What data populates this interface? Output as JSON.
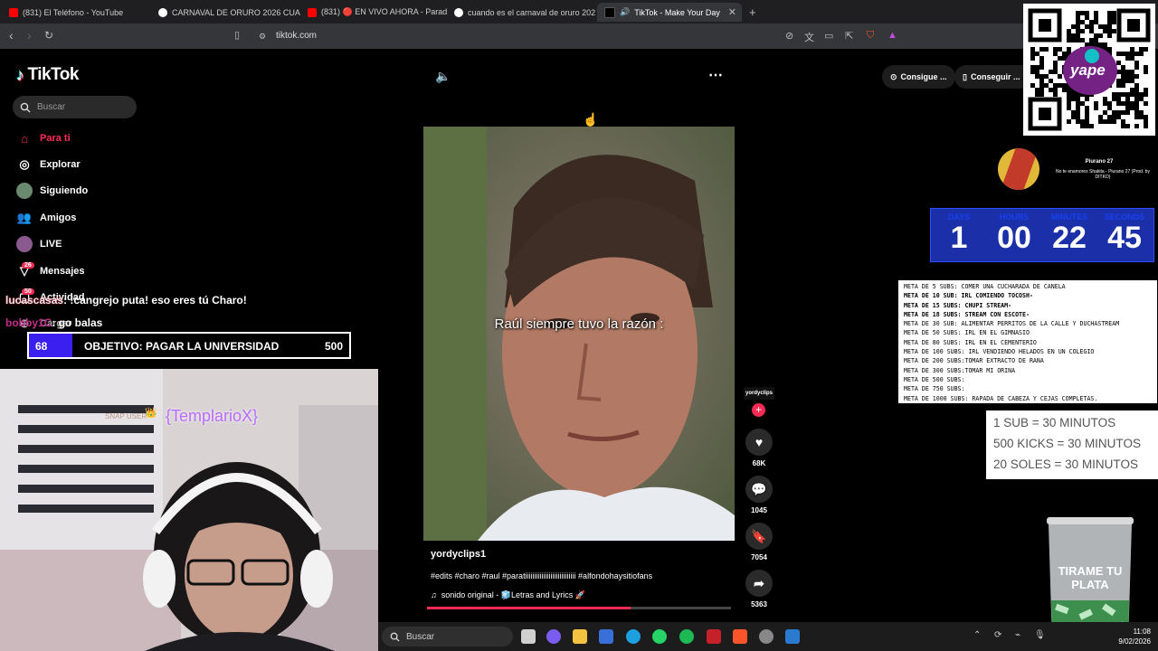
{
  "browser": {
    "tabs": [
      {
        "title": "(831) El Teléfono - YouTube",
        "active": false
      },
      {
        "title": "CARNAVAL DE ORURO 2026 CUANDO",
        "active": false
      },
      {
        "title": "(831) 🔴 EN VIVO AHORA - Parada y",
        "active": false
      },
      {
        "title": "cuando es el carnaval de oruro 2026",
        "active": false
      },
      {
        "title": "TikTok - Make Your Day",
        "active": true
      }
    ],
    "url": "tiktok.com"
  },
  "tiktok": {
    "logo": "TikTok",
    "search_placeholder": "Buscar",
    "nav": [
      {
        "label": "Para ti",
        "icon": "home-icon",
        "active": true
      },
      {
        "label": "Explorar",
        "icon": "compass-icon"
      },
      {
        "label": "Siguiendo",
        "icon": "following-avatar-icon"
      },
      {
        "label": "Amigos",
        "icon": "friends-icon"
      },
      {
        "label": "LIVE",
        "icon": "live-avatar-icon"
      },
      {
        "label": "Mensajes",
        "icon": "messages-icon",
        "badge": "26"
      },
      {
        "label": "Actividad",
        "icon": "activity-icon",
        "badge": "50"
      },
      {
        "label": "Cargar",
        "icon": "upload-icon"
      }
    ],
    "top_buttons": [
      "Consigue ...",
      "Conseguir ..."
    ],
    "video": {
      "caption": "Raúl siempre tuvo la razón :",
      "author": "yordyclips1",
      "tags": "#edits #charo #raul #paratiiiiiiiiiiiiiiiiiiiiiiiiiiii #alfondohaysitiofans",
      "sound": "sonido original - 🧊Letras and Lyrics 🚀",
      "progress": 0.67
    },
    "actions": {
      "likes": "68K",
      "comments": "1045",
      "saves": "7054",
      "shares": "5363",
      "avatar_label": "yordyclips"
    }
  },
  "stream": {
    "chat": [
      {
        "user": "lucascasas",
        "message": ": !cangrejo puta! eso eres tú Charo!"
      },
      {
        "user": "bobby1C",
        "message": ": go balas"
      }
    ],
    "goal": {
      "current": "68",
      "label": "OBJETIVO: PAGAR LA UNIVERSIDAD",
      "target": "500",
      "fraction": 0.136
    },
    "webcam_overlay": {
      "prefix": "SNAP USER",
      "user": "{TemplarioX}"
    },
    "song": {
      "title": "Piurano 27",
      "subtitle": "No te enamores Shakita - Piurano 27 (Prod. by DITKO)"
    },
    "timer": [
      {
        "label": "DAYS",
        "value": "1"
      },
      {
        "label": "HOURS",
        "value": "00"
      },
      {
        "label": "MINUTES",
        "value": "22"
      },
      {
        "label": "SECONDS",
        "value": "45"
      }
    ],
    "metas": [
      {
        "text": "META DE 5 SUBS: COMER UNA CUCHARADA DE CANELA",
        "bold": false
      },
      {
        "text": "META DE 10 SUB: IRL COMIENDO TOCOSH-",
        "bold": true
      },
      {
        "text": "META DE 15 SUBS: CHUPI STREAM-",
        "bold": true
      },
      {
        "text": "META DE 18 SUBS: STREAM CON ESCOTE-",
        "bold": true
      },
      {
        "text": "META DE 30 SUB:  ALIMENTAR PERRITOS DE LA CALLE Y DUCHASTREAM",
        "bold": false
      },
      {
        "text": "META DE 50 SUBS: IRL EN EL GIMNASIO",
        "bold": false
      },
      {
        "text": "META DE 80 SUBS: IRL EN EL CEMENTERIO",
        "bold": false
      },
      {
        "text": "META DE 100 SUBS: IRL VENDIENDO HELADOS EN UN COLEGIO",
        "bold": false
      },
      {
        "text": "META DE 200 SUBS:TOMAR EXTRACTO DE RANA",
        "bold": false
      },
      {
        "text": "META DE 300 SUBS:TOMAR MI ORINA",
        "bold": false
      },
      {
        "text": "META DE 500 SUBS:",
        "bold": false
      },
      {
        "text": "META DE 750 SUBS:",
        "bold": false
      },
      {
        "text": "META DE 1000 SUBS: RAPADA DE CABEZA Y CEJAS COMPLETAS.",
        "bold": false
      }
    ],
    "rates": [
      "1 SUB = 30 MINUTOS",
      "500 KICKS = 30 MINUTOS",
      "20 SOLES = 30 MINUTOS"
    ],
    "jar_text": "TIRAME TU PLATA",
    "qr_text": "yape"
  },
  "taskbar": {
    "search": "Buscar",
    "time": "11:08",
    "date": "9/02/2026"
  }
}
